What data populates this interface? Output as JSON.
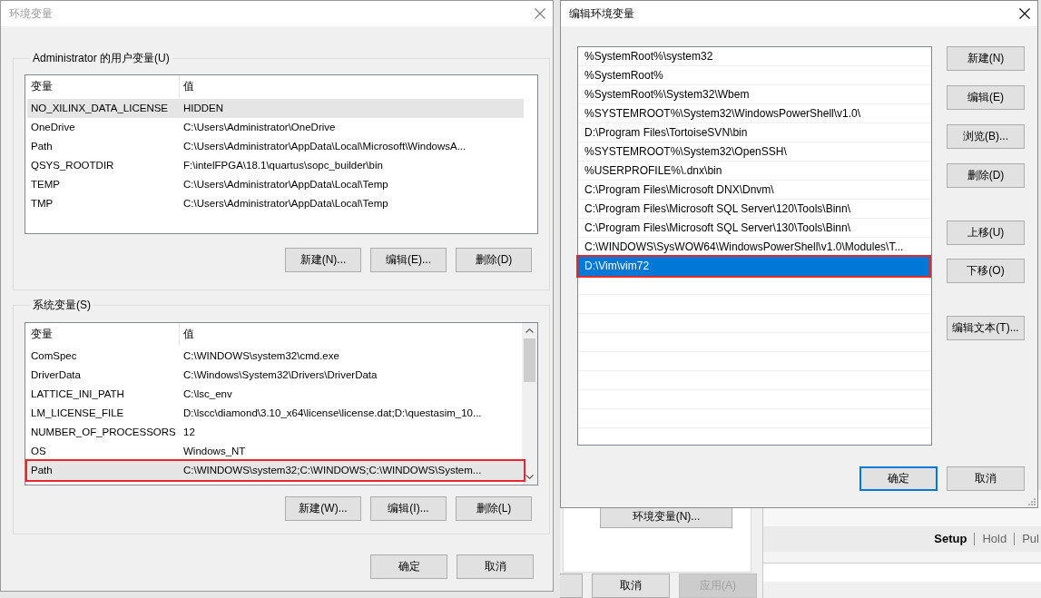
{
  "env_dialog": {
    "title": "环境变量",
    "active": false,
    "user_vars": {
      "label": "Administrator 的用户变量(U)",
      "columns": [
        "变量",
        "值"
      ],
      "scrollbar": false,
      "rows": [
        {
          "name": "NO_XILINX_DATA_LICENSE",
          "value": "HIDDEN",
          "selected": true,
          "highlighted": false
        },
        {
          "name": "OneDrive",
          "value": "C:\\Users\\Administrator\\OneDrive",
          "selected": false,
          "highlighted": false
        },
        {
          "name": "Path",
          "value": "C:\\Users\\Administrator\\AppData\\Local\\Microsoft\\WindowsA...",
          "selected": false,
          "highlighted": false
        },
        {
          "name": "QSYS_ROOTDIR",
          "value": "F:\\intelFPGA\\18.1\\quartus\\sopc_builder\\bin",
          "selected": false,
          "highlighted": false
        },
        {
          "name": "TEMP",
          "value": "C:\\Users\\Administrator\\AppData\\Local\\Temp",
          "selected": false,
          "highlighted": false
        },
        {
          "name": "TMP",
          "value": "C:\\Users\\Administrator\\AppData\\Local\\Temp",
          "selected": false,
          "highlighted": false
        }
      ],
      "buttons": [
        "新建(N)...",
        "编辑(E)...",
        "删除(D)"
      ]
    },
    "system_vars": {
      "label": "系统变量(S)",
      "columns": [
        "变量",
        "值"
      ],
      "scrollbar": true,
      "rows": [
        {
          "name": "ComSpec",
          "value": "C:\\WINDOWS\\system32\\cmd.exe",
          "selected": false,
          "highlighted": false
        },
        {
          "name": "DriverData",
          "value": "C:\\Windows\\System32\\Drivers\\DriverData",
          "selected": false,
          "highlighted": false
        },
        {
          "name": "LATTICE_INI_PATH",
          "value": "C:\\lsc_env",
          "selected": false,
          "highlighted": false
        },
        {
          "name": "LM_LICENSE_FILE",
          "value": "D:\\lscc\\diamond\\3.10_x64\\license\\license.dat;D:\\questasim_10...",
          "selected": false,
          "highlighted": false
        },
        {
          "name": "NUMBER_OF_PROCESSORS",
          "value": "12",
          "selected": false,
          "highlighted": false
        },
        {
          "name": "OS",
          "value": "Windows_NT",
          "selected": false,
          "highlighted": false
        },
        {
          "name": "Path",
          "value": "C:\\WINDOWS\\system32;C:\\WINDOWS;C:\\WINDOWS\\System...",
          "selected": true,
          "highlighted": true
        }
      ],
      "buttons": [
        "新建(W)...",
        "编辑(I)...",
        "删除(L)"
      ]
    },
    "buttons": [
      "确定",
      "取消"
    ]
  },
  "edit_dialog": {
    "title": "编辑环境变量",
    "active": true,
    "entries": [
      {
        "text": "%SystemRoot%\\system32",
        "selected": false,
        "highlighted": false
      },
      {
        "text": "%SystemRoot%",
        "selected": false,
        "highlighted": false
      },
      {
        "text": "%SystemRoot%\\System32\\Wbem",
        "selected": false,
        "highlighted": false
      },
      {
        "text": "%SYSTEMROOT%\\System32\\WindowsPowerShell\\v1.0\\",
        "selected": false,
        "highlighted": false
      },
      {
        "text": "D:\\Program Files\\TortoiseSVN\\bin",
        "selected": false,
        "highlighted": false
      },
      {
        "text": "%SYSTEMROOT%\\System32\\OpenSSH\\",
        "selected": false,
        "highlighted": false
      },
      {
        "text": "%USERPROFILE%\\.dnx\\bin",
        "selected": false,
        "highlighted": false
      },
      {
        "text": "C:\\Program Files\\Microsoft DNX\\Dnvm\\",
        "selected": false,
        "highlighted": false
      },
      {
        "text": "C:\\Program Files\\Microsoft SQL Server\\120\\Tools\\Binn\\",
        "selected": false,
        "highlighted": false
      },
      {
        "text": "C:\\Program Files\\Microsoft SQL Server\\130\\Tools\\Binn\\",
        "selected": false,
        "highlighted": false
      },
      {
        "text": "C:\\WINDOWS\\SysWOW64\\WindowsPowerShell\\v1.0\\Modules\\T...",
        "selected": false,
        "highlighted": false
      },
      {
        "text": "D:\\Vim\\vim72",
        "selected": true,
        "highlighted": true
      }
    ],
    "button_groups": [
      [
        "新建(N)",
        "编辑(E)",
        "浏览(B)...",
        "删除(D)"
      ],
      [
        "上移(U)",
        "下移(O)"
      ],
      [
        "编辑文本(T)..."
      ]
    ],
    "footer_buttons": [
      {
        "label": "确定",
        "focused": true
      },
      {
        "label": "取消",
        "focused": false
      }
    ]
  },
  "background_window": {
    "environment_button": "环境变量(N)...",
    "buttons": [
      {
        "label": "取消",
        "disabled": false
      },
      {
        "label": "应用(A)",
        "disabled": true
      }
    ],
    "analysis_tabs": [
      {
        "label": "Setup",
        "selected": true
      },
      {
        "label": "Hold",
        "selected": false
      },
      {
        "label": "Pul",
        "selected": false
      }
    ]
  }
}
